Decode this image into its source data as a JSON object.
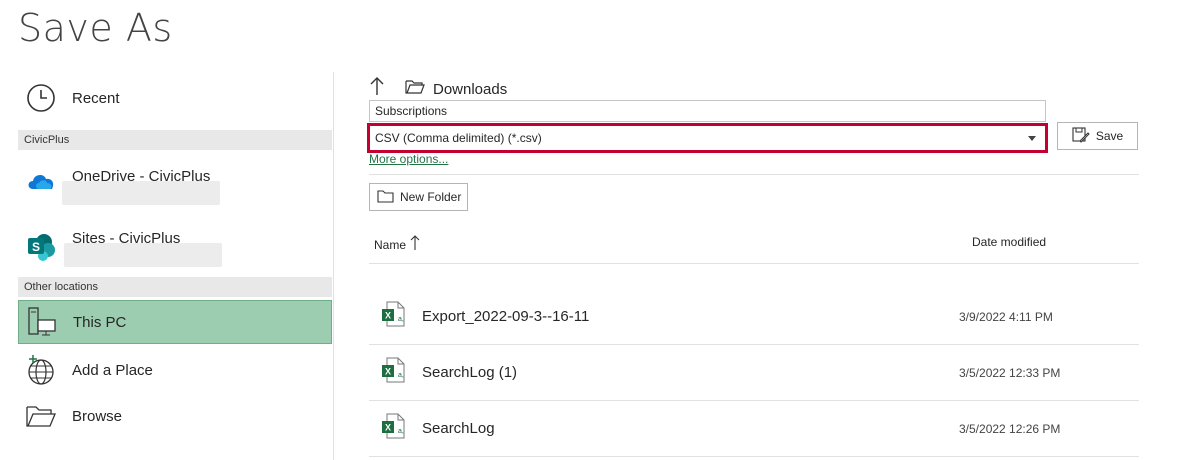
{
  "page": {
    "title": "Save As"
  },
  "sidebar": {
    "recent_label": "Recent",
    "section_civicplus": "CivicPlus",
    "onedrive_label": "OneDrive - CivicPlus",
    "sites_label": "Sites - CivicPlus",
    "section_other": "Other locations",
    "this_pc_label": "This PC",
    "add_place_label": "Add a Place",
    "browse_label": "Browse"
  },
  "main": {
    "breadcrumb_folder": "Downloads",
    "filename_value": "Subscriptions",
    "filetype_value": "CSV (Comma delimited) (*.csv)",
    "more_options_label": "More options...",
    "save_label": "Save",
    "new_folder_label": "New Folder",
    "col_name": "Name",
    "col_date": "Date modified",
    "files": [
      {
        "name": "Export_2022-09-3--16-11",
        "date": "3/9/2022 4:11 PM"
      },
      {
        "name": "SearchLog (1)",
        "date": "3/5/2022 12:33 PM"
      },
      {
        "name": "SearchLog",
        "date": "3/5/2022 12:26 PM"
      }
    ]
  },
  "colors": {
    "accent_green": "#217346",
    "selected_bg": "#9dcdb0",
    "highlight_red": "#c3002f"
  }
}
